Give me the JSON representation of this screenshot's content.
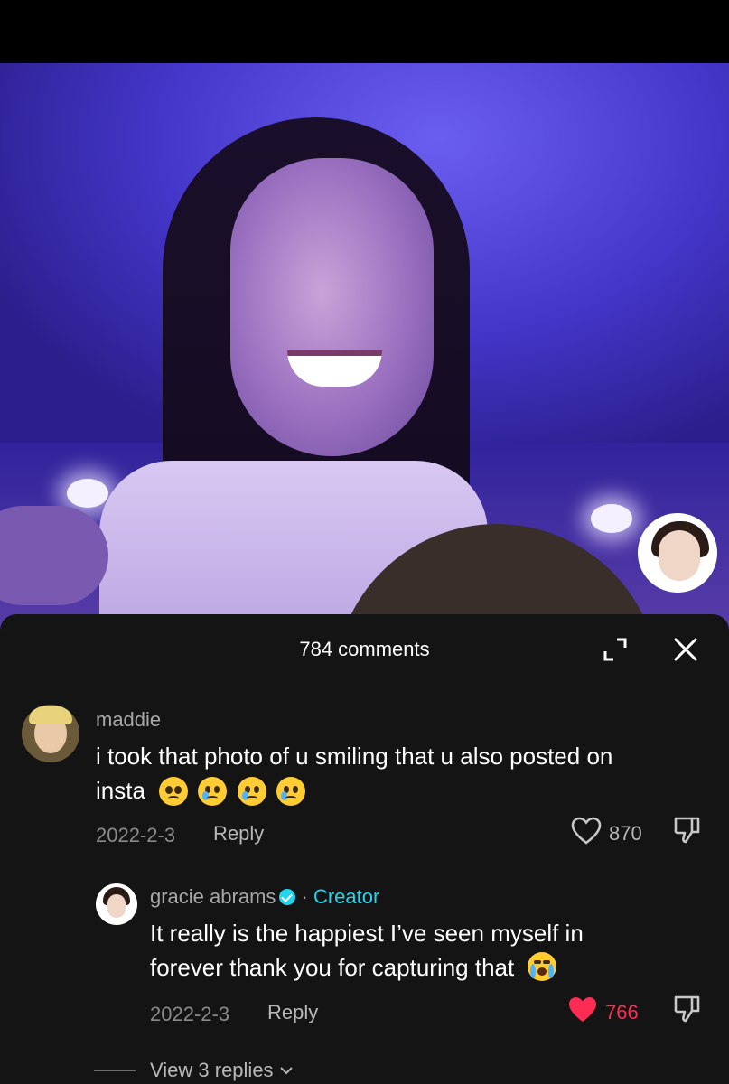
{
  "sheet": {
    "comments_count": "784 comments"
  },
  "comments": [
    {
      "username": "maddie",
      "text_line1": "i took that photo of u smiling that u also posted on",
      "text_line2": "insta",
      "emojis": [
        "pleading-face",
        "crying-face",
        "crying-face",
        "crying-face"
      ],
      "date": "2022-2-3",
      "reply_label": "Reply",
      "likes": "870",
      "liked": false
    },
    {
      "username": "gracie abrams",
      "creator_label": "Creator",
      "separator": "·",
      "text_line1": "It really is the happiest I’ve seen myself in",
      "text_line2": "forever thank you for capturing that",
      "emojis": [
        "loudly-crying-face"
      ],
      "date": "2022-2-3",
      "reply_label": "Reply",
      "likes": "766",
      "liked": true
    }
  ],
  "view_replies": "View 3 replies",
  "colors": {
    "sheet_bg": "#141414",
    "accent_like": "#fe2c55",
    "creator": "#20d5ec"
  }
}
